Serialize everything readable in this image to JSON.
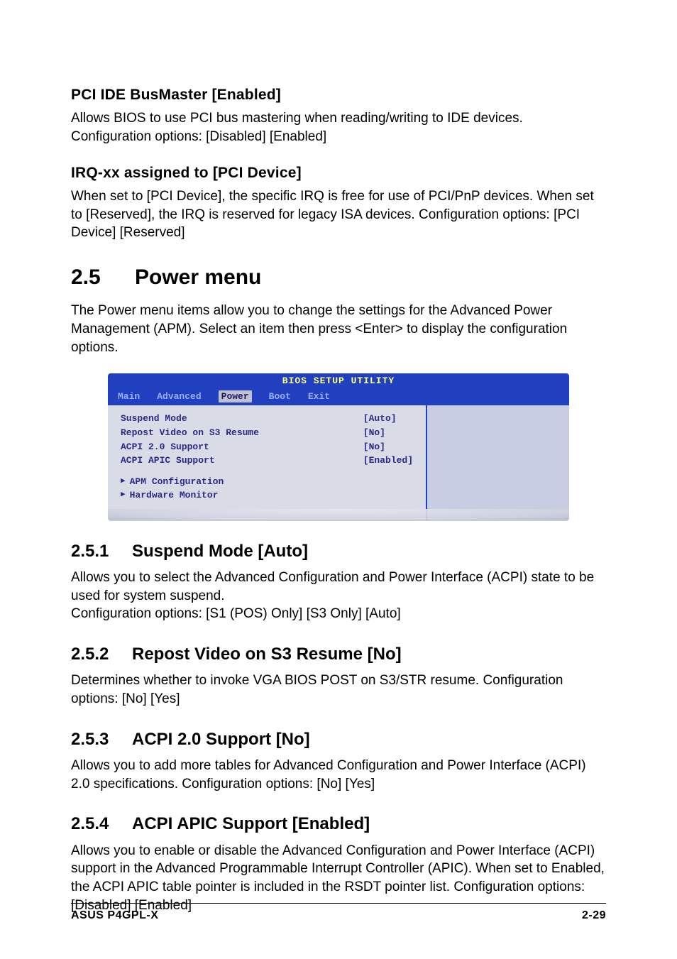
{
  "head1": {
    "title": "PCI IDE BusMaster [Enabled]",
    "body": "Allows BIOS to use PCI bus mastering when reading/writing to IDE devices. Configuration options: [Disabled] [Enabled]"
  },
  "head2": {
    "title": "IRQ-xx assigned to [PCI Device]",
    "body": "When set to [PCI Device], the specific IRQ is free for use of PCI/PnP devices. When set to [Reserved], the IRQ is reserved for legacy ISA devices. Configuration options: [PCI Device] [Reserved]"
  },
  "section": {
    "num": "2.5",
    "title": "Power menu",
    "intro": "The Power menu items allow you to change the settings for the Advanced Power Management (APM). Select an item then press <Enter> to display the configuration options."
  },
  "bios": {
    "title": "BIOS SETUP UTILITY",
    "tabs": [
      "Main",
      "Advanced",
      "Power",
      "Boot",
      "Exit"
    ],
    "selected_tab_index": 2,
    "rows": [
      {
        "label": "Suspend Mode",
        "value": "[Auto]"
      },
      {
        "label": "Repost Video on S3 Resume",
        "value": "[No]"
      },
      {
        "label": "ACPI 2.0 Support",
        "value": "[No]"
      },
      {
        "label": "ACPI APIC Support",
        "value": "[Enabled]"
      }
    ],
    "submenus": [
      "APM Configuration",
      "Hardware Monitor"
    ]
  },
  "subs": [
    {
      "num": "2.5.1",
      "title": "Suspend Mode [Auto]",
      "body": "Allows you to select the Advanced Configuration and Power Interface (ACPI) state to be used for system suspend.\nConfiguration options: [S1 (POS) Only] [S3 Only] [Auto]"
    },
    {
      "num": "2.5.2",
      "title": "Repost Video on S3 Resume [No]",
      "body": "Determines whether to invoke VGA BIOS POST on S3/STR resume. Configuration options: [No] [Yes]"
    },
    {
      "num": "2.5.3",
      "title": "ACPI 2.0 Support [No]",
      "body": "Allows you to add more tables for Advanced Configuration and Power Interface (ACPI) 2.0 specifications. Configuration options: [No] [Yes]"
    },
    {
      "num": "2.5.4",
      "title": "ACPI APIC Support [Enabled]",
      "body": "Allows you to enable or disable the Advanced Configuration and Power Interface (ACPI) support in the Advanced Programmable Interrupt Controller (APIC). When set to Enabled, the ACPI APIC table pointer is included in the RSDT pointer list. Configuration options: [Disabled] [Enabled]"
    }
  ],
  "footer": {
    "left": "ASUS P4GPL-X",
    "right": "2-29"
  }
}
